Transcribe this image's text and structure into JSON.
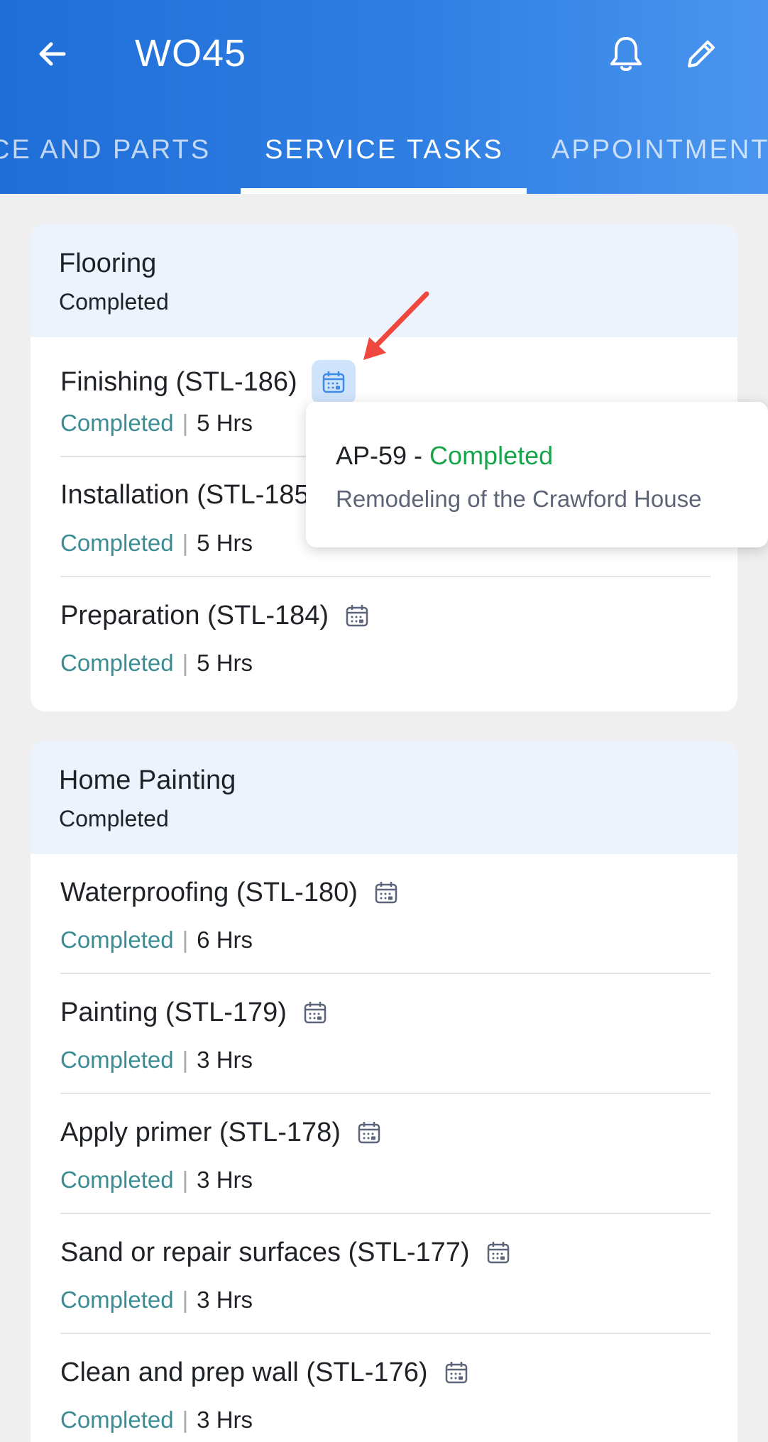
{
  "header": {
    "title": "WO45",
    "tabs": [
      "CE AND PARTS",
      "SERVICE TASKS",
      "APPOINTMENTS"
    ],
    "active_tab": "SERVICE TASKS",
    "back_icon": "arrow-left-icon",
    "bell_icon": "bell-icon",
    "edit_icon": "pencil-icon"
  },
  "groups": [
    {
      "name": "Flooring",
      "status": "Completed",
      "tasks": [
        {
          "name": "Finishing (STL-186)",
          "status": "Completed",
          "hours": "5 Hrs"
        },
        {
          "name": "Installation (STL-185)",
          "status": "Completed",
          "hours": "5 Hrs"
        },
        {
          "name": "Preparation (STL-184)",
          "status": "Completed",
          "hours": "5 Hrs"
        }
      ]
    },
    {
      "name": "Home Painting",
      "status": "Completed",
      "tasks": [
        {
          "name": "Waterproofing (STL-180)",
          "status": "Completed",
          "hours": "6 Hrs"
        },
        {
          "name": "Painting (STL-179)",
          "status": "Completed",
          "hours": "3 Hrs"
        },
        {
          "name": "Apply primer (STL-178)",
          "status": "Completed",
          "hours": "3 Hrs"
        },
        {
          "name": "Sand or repair surfaces (STL-177)",
          "status": "Completed",
          "hours": "3 Hrs"
        },
        {
          "name": "Clean and prep wall (STL-176)",
          "status": "Completed",
          "hours": "3 Hrs"
        }
      ]
    }
  ],
  "popover": {
    "appointment_id": "AP-59 - ",
    "appointment_status": "Completed",
    "description": "Remodeling of the Crawford House"
  },
  "separator": "|",
  "colors": {
    "header": "#2a78e0",
    "task_status": "#3b8c93",
    "popover_status": "#18a54a",
    "group_header_bg": "#ecf3fd",
    "annotation_arrow": "#f0483e"
  }
}
